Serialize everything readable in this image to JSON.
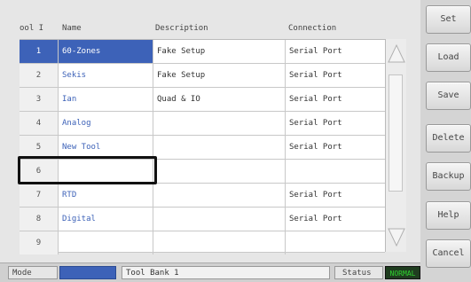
{
  "table": {
    "headers": [
      "ool I",
      "Name",
      "Description",
      "Connection"
    ],
    "rows": [
      {
        "num": "1",
        "name": "60-Zones",
        "desc": "Fake Setup",
        "conn": "Serial Port"
      },
      {
        "num": "2",
        "name": "Sekis",
        "desc": "Fake Setup",
        "conn": "Serial Port"
      },
      {
        "num": "3",
        "name": "Ian",
        "desc": "Quad & IO",
        "conn": "Serial Port"
      },
      {
        "num": "4",
        "name": "Analog",
        "desc": "",
        "conn": "Serial Port"
      },
      {
        "num": "5",
        "name": "New Tool",
        "desc": "",
        "conn": "Serial Port"
      },
      {
        "num": "6",
        "name": "",
        "desc": "",
        "conn": ""
      },
      {
        "num": "7",
        "name": "RTD",
        "desc": "",
        "conn": "Serial Port"
      },
      {
        "num": "8",
        "name": "Digital",
        "desc": "",
        "conn": "Serial Port"
      },
      {
        "num": "9",
        "name": "",
        "desc": "",
        "conn": ""
      }
    ]
  },
  "buttons": [
    "Set",
    "Load",
    "Save",
    "Delete",
    "Backup",
    "Help",
    "Cancel"
  ],
  "status_bar": {
    "mode_label": "Mode",
    "bank_text": "Tool Bank 1",
    "status_label": "Status",
    "status_value": "NORMAL"
  },
  "colors": {
    "selection": "#3d62b8",
    "name_text": "#3d62b8",
    "status_ok": "#2fd32f",
    "highlight_box": "#111111"
  }
}
